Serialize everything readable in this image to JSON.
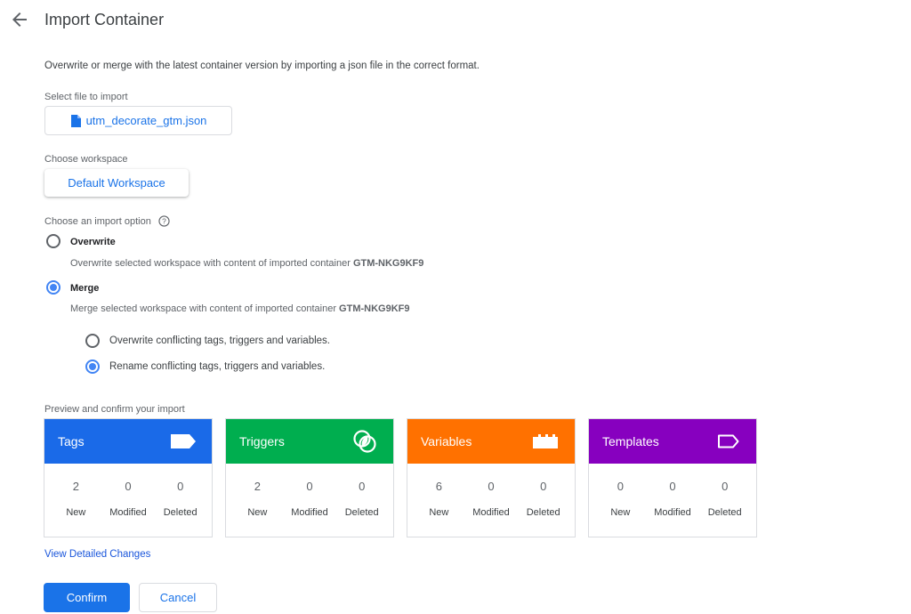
{
  "header": {
    "title": "Import Container",
    "back_icon": "arrow-left-icon"
  },
  "description": "Overwrite or merge with the latest container version by importing a json file in the correct format.",
  "file": {
    "label": "Select file to import",
    "filename": "utm_decorate_gtm.json",
    "icon": "file-icon"
  },
  "workspace": {
    "label": "Choose workspace",
    "value": "Default Workspace"
  },
  "import_option": {
    "label": "Choose an import option",
    "help_icon": "help-icon",
    "options": [
      {
        "title": "Overwrite",
        "desc": "Overwrite selected workspace with content of imported container ",
        "container": "GTM-NKG9KF9",
        "selected": false
      },
      {
        "title": "Merge",
        "desc": "Merge selected workspace with content of imported container ",
        "container": "GTM-NKG9KF9",
        "selected": true
      }
    ],
    "merge_options": [
      {
        "label": "Overwrite conflicting tags, triggers and variables.",
        "selected": false
      },
      {
        "label": "Rename conflicting tags, triggers and variables.",
        "selected": true
      }
    ]
  },
  "preview": {
    "label": "Preview and confirm your import",
    "cards": [
      {
        "title": "Tags",
        "color": "#1a6ae8",
        "icon": "tag-icon",
        "new": "2",
        "modified": "0",
        "deleted": "0"
      },
      {
        "title": "Triggers",
        "color": "#00ae4f",
        "icon": "trigger-icon",
        "new": "2",
        "modified": "0",
        "deleted": "0"
      },
      {
        "title": "Variables",
        "color": "#ff7100",
        "icon": "variable-icon",
        "new": "6",
        "modified": "0",
        "deleted": "0"
      },
      {
        "title": "Templates",
        "color": "#8700bf",
        "icon": "template-icon",
        "new": "0",
        "modified": "0",
        "deleted": "0"
      }
    ],
    "stat_labels": {
      "new": "New",
      "modified": "Modified",
      "deleted": "Deleted"
    }
  },
  "view_changes": "View Detailed Changes",
  "actions": {
    "confirm": "Confirm",
    "cancel": "Cancel"
  }
}
